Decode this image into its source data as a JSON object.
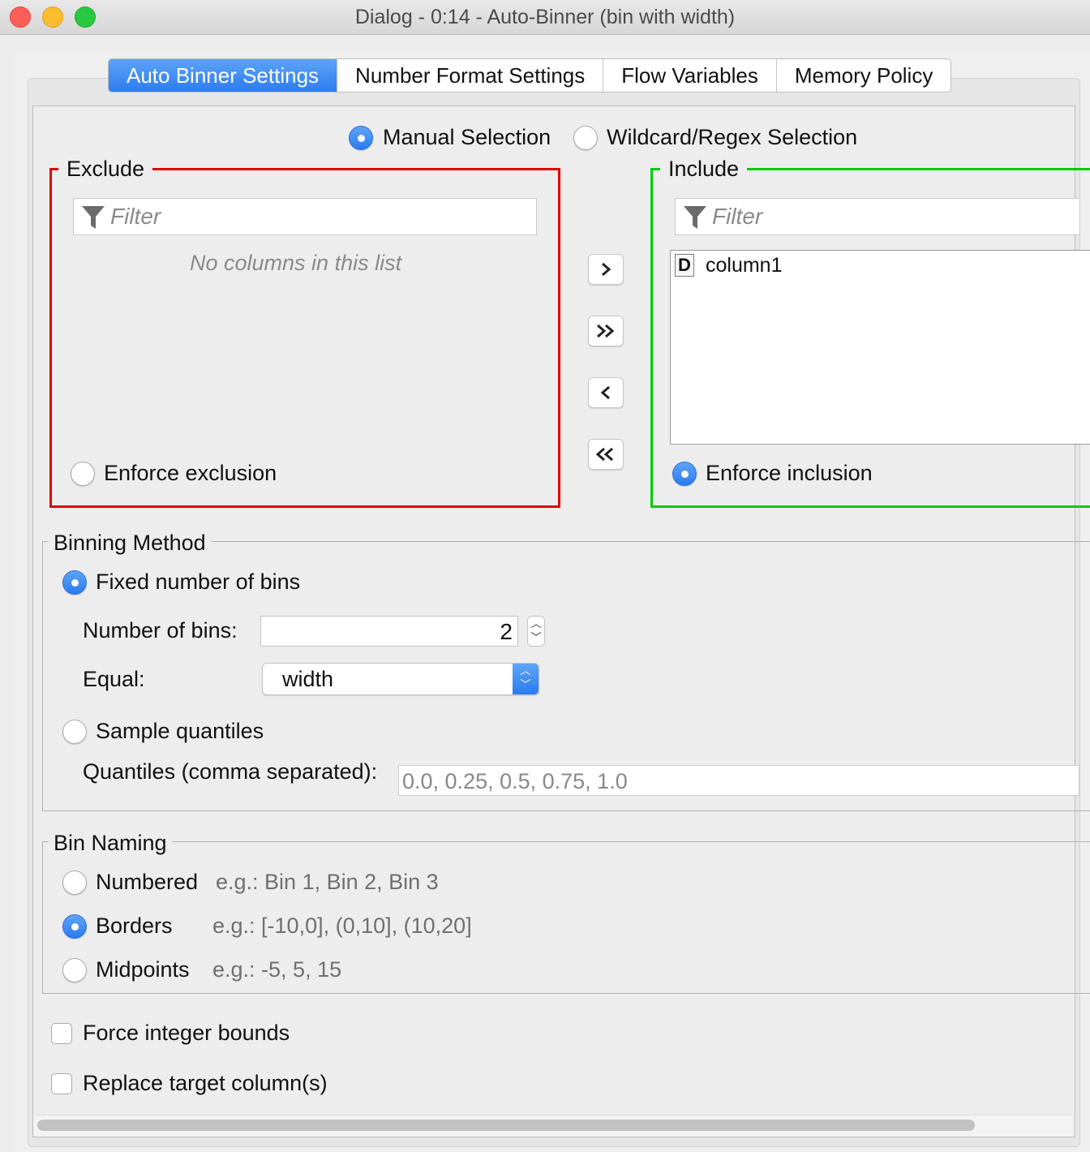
{
  "window": {
    "title": "Dialog - 0:14 - Auto-Binner (bin with width)",
    "traffic_lights": {
      "close": "#fe5f57",
      "minimize": "#febc2e",
      "zoom": "#28c840"
    }
  },
  "tabs": [
    {
      "label": "Auto Binner Settings",
      "active": true
    },
    {
      "label": "Number Format Settings",
      "active": false
    },
    {
      "label": "Flow Variables",
      "active": false
    },
    {
      "label": "Memory Policy",
      "active": false
    }
  ],
  "selection_mode": {
    "manual": {
      "label": "Manual Selection",
      "selected": true
    },
    "wildcard": {
      "label": "Wildcard/Regex Selection",
      "selected": false
    }
  },
  "exclude": {
    "title": "Exclude",
    "border_color": "#e00000",
    "filter_placeholder": "Filter",
    "empty_text": "No columns in this list",
    "enforce_label": "Enforce exclusion",
    "enforce_selected": false
  },
  "include": {
    "title": "Include",
    "border_color": "#00cc00",
    "filter_placeholder": "Filter",
    "columns": [
      {
        "type": "D",
        "name": "column1"
      }
    ],
    "enforce_label": "Enforce inclusion",
    "enforce_selected": true
  },
  "move_buttons": {
    "add": ">",
    "add_all": "»",
    "remove": "<",
    "remove_all": "«"
  },
  "binning_method": {
    "title": "Binning Method",
    "fixed_label": "Fixed number of bins",
    "fixed_selected": true,
    "num_bins_label": "Number of bins:",
    "num_bins_value": "2",
    "equal_label": "Equal:",
    "equal_value": "width",
    "quantiles_label": "Sample quantiles",
    "quantiles_selected": false,
    "quantiles_field_label": "Quantiles (comma separated):",
    "quantiles_value": "0.0, 0.25, 0.5, 0.75, 1.0"
  },
  "bin_naming": {
    "title": "Bin Naming",
    "options": [
      {
        "label": "Numbered",
        "example": "e.g.: Bin 1, Bin 2, Bin 3",
        "selected": false
      },
      {
        "label": "Borders",
        "example": "e.g.: [-10,0], (0,10], (10,20]",
        "selected": true
      },
      {
        "label": "Midpoints",
        "example": "e.g.: -5, 5, 15",
        "selected": false
      }
    ]
  },
  "options": {
    "force_integer_label": "Force integer bounds",
    "force_integer_checked": false,
    "replace_target_label": "Replace target column(s)",
    "replace_target_checked": false
  }
}
